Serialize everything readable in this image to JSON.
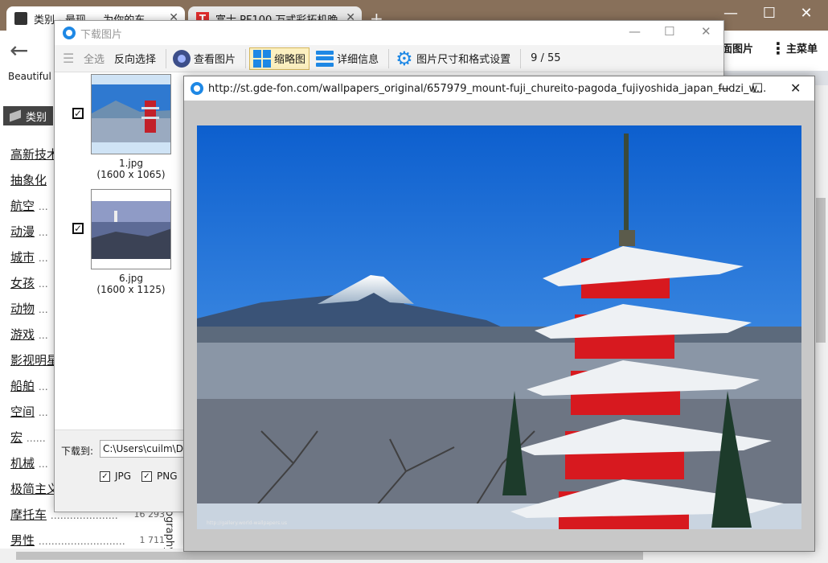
{
  "browser": {
    "tabs": [
      {
        "label": "类别 - 最现 — 为你的东"
      },
      {
        "label": "富士 PF100 万式彩拓机晚"
      }
    ],
    "new_tab_glyph": "+",
    "window_controls": {
      "minimize": "—",
      "maximize": "☐",
      "close": "✕"
    },
    "toolbar_right": {
      "images_label": "面图片",
      "menu_label": "主菜单"
    },
    "bookmark_label": "Beautiful F"
  },
  "site": {
    "category_header": "类别",
    "categories": [
      {
        "name": "高新技术",
        "dots": "",
        "count": ""
      },
      {
        "name": "抽象化",
        "dots": "",
        "count": ""
      },
      {
        "name": "航空",
        "dots": "…",
        "count": ""
      },
      {
        "name": "动漫",
        "dots": "…",
        "count": ""
      },
      {
        "name": "城市",
        "dots": "…",
        "count": ""
      },
      {
        "name": "女孩",
        "dots": "…",
        "count": ""
      },
      {
        "name": "动物",
        "dots": "…",
        "count": ""
      },
      {
        "name": "游戏",
        "dots": "…",
        "count": ""
      },
      {
        "name": "影视明星",
        "dots": "",
        "count": ""
      },
      {
        "name": "船舶",
        "dots": "…",
        "count": ""
      },
      {
        "name": "空间",
        "dots": "…",
        "count": ""
      },
      {
        "name": "宏",
        "dots": "……",
        "count": ""
      },
      {
        "name": "机械",
        "dots": "…",
        "count": ""
      },
      {
        "name": "极简主义",
        "dots": "",
        "count": ""
      },
      {
        "name": "摩托车",
        "dots": "…………………",
        "count": "16 293"
      },
      {
        "name": "男性",
        "dots": "………………………",
        "count": "1 711"
      }
    ],
    "vertical_text": "Geography"
  },
  "download_dialog": {
    "title": "下载图片",
    "toolbar": {
      "select_all": "全选",
      "invert_selection": "反向选择",
      "view_image": "查看图片",
      "thumbnails": "缩略图",
      "details": "详细信息",
      "size_format_settings": "图片尺寸和格式设置",
      "counter": "9 / 55"
    },
    "thumbnails": [
      {
        "filename": "1.jpg",
        "dimensions": "(1600 x 1065)",
        "checked": true
      },
      {
        "filename": "6.jpg",
        "dimensions": "(1600 x 1125)",
        "checked": true
      }
    ],
    "download_to_label": "下载到:",
    "download_path": "C:\\Users\\cuilm\\Des",
    "formats": [
      {
        "label": "JPG",
        "checked": true
      },
      {
        "label": "PNG",
        "checked": true
      }
    ],
    "check_glyph": "✓"
  },
  "viewer": {
    "url": "http://st.gde-fon.com/wallpapers_original/657979_mount-fuji_chureito-pagoda_fujiyoshida_japan_fudzi_w...",
    "watermark": "http://gallery.world-wallpapers.us"
  },
  "colors": {
    "accent": "#1e88e5",
    "tabstrip": "#88705a",
    "pagoda_red": "#d7191f"
  },
  "icons": [
    "select-all-icon",
    "eye-icon",
    "thumbnails-grid-icon",
    "details-list-icon",
    "gear-icon",
    "app-icon",
    "back-arrow-icon",
    "kebab-menu-icon"
  ]
}
